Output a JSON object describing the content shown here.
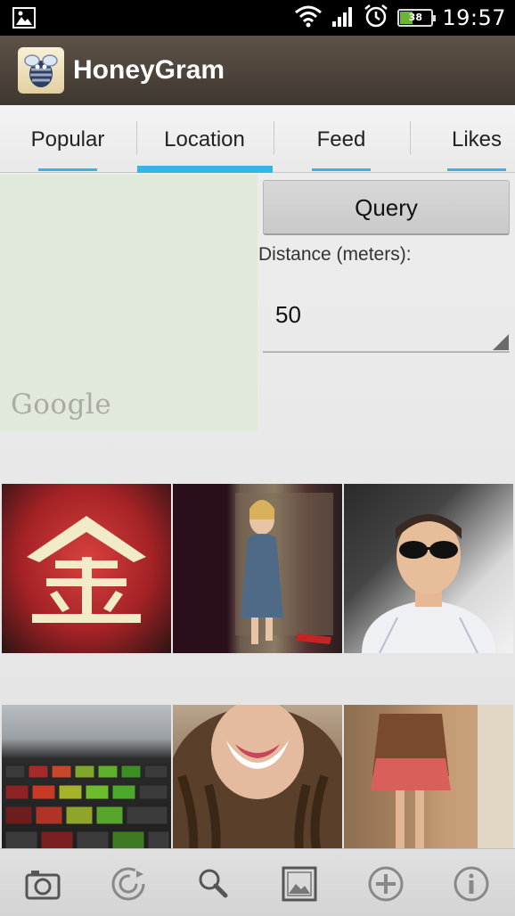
{
  "status_bar": {
    "time": "19:57",
    "battery_level": "38",
    "battery_fraction": 0.38,
    "icons": [
      "gallery-notification-icon",
      "wifi-icon",
      "signal-icon",
      "alarm-icon",
      "battery-icon"
    ]
  },
  "app": {
    "title": "HoneyGram",
    "logo_icon": "bee-icon"
  },
  "tabs": [
    {
      "label": "Popular",
      "active": false
    },
    {
      "label": "Location",
      "active": true
    },
    {
      "label": "Feed",
      "active": false
    },
    {
      "label": "Likes",
      "active": false
    }
  ],
  "map": {
    "watermark": "Google"
  },
  "query": {
    "button_label": "Query",
    "distance_label": "Distance (meters):",
    "distance_value": "50"
  },
  "photo_grid": {
    "photos": [
      {
        "icon": "photo-red-sign"
      },
      {
        "icon": "photo-woman-dress"
      },
      {
        "icon": "photo-man-sunglasses"
      },
      {
        "icon": "photo-keyboard"
      },
      {
        "icon": "photo-woman-hair"
      },
      {
        "icon": "photo-legs-mirror"
      }
    ]
  },
  "bottom_bar": {
    "icons": [
      "camera-icon",
      "refresh-icon",
      "search-icon",
      "gallery-icon",
      "add-icon",
      "info-icon"
    ]
  },
  "colors": {
    "accent": "#33b5e5",
    "action_bar": "#4d4439",
    "map_background": "#e0e9da"
  }
}
